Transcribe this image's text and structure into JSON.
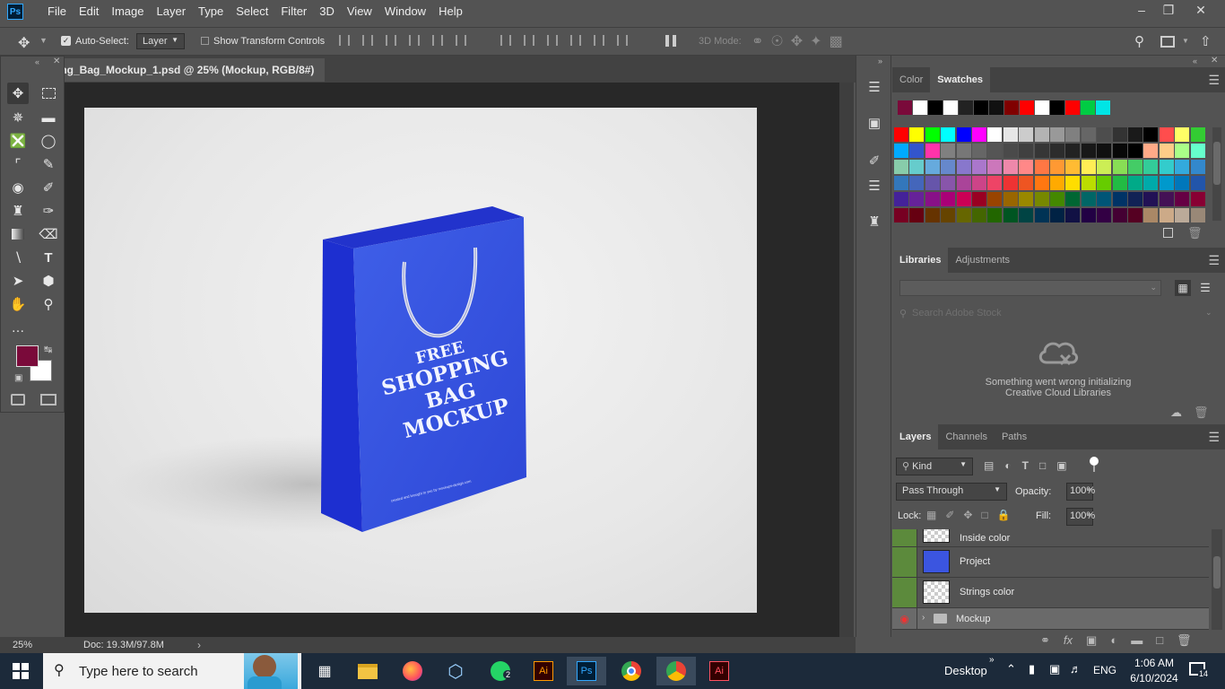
{
  "menu": [
    "File",
    "Edit",
    "Image",
    "Layer",
    "Type",
    "Select",
    "Filter",
    "3D",
    "View",
    "Window",
    "Help"
  ],
  "app_logo": "Ps",
  "options": {
    "auto_select_label": "Auto-Select:",
    "auto_select_value": "Layer",
    "show_transform_label": "Show Transform Controls",
    "mode_3d_label": "3D Mode:"
  },
  "document": {
    "tab_title": "ing_Bag_Mockup_1.psd @ 25% (Mockup, RGB/8#)",
    "close": "×",
    "zoom": "25%",
    "doc_info": "Doc: 19.3M/97.8M"
  },
  "mockup": {
    "line1": "FREE",
    "line2": "SHOPPING",
    "line3": "BAG MOCKUP",
    "footer": "created and brought to you by mockups-design.com"
  },
  "color_panel": {
    "tabs": [
      "Color",
      "Swatches"
    ],
    "active_tab": "Swatches",
    "recent_swatches": [
      "#7a0a3a",
      "#ffffff",
      "#000000",
      "#ffffff",
      "#222222",
      "#000000",
      "#111111",
      "#800000",
      "#ff0000",
      "#ffffff",
      "#000000",
      "#ff0000",
      "#00cc44",
      "#00e5e5"
    ],
    "swatch_rows": [
      [
        "#ff0000",
        "#ffff00",
        "#00ff00",
        "#00ffff",
        "#0000ff",
        "#ff00ff",
        "#ffffff",
        "#e6e6e6",
        "#cccccc",
        "#b3b3b3",
        "#999999",
        "#808080",
        "#666666",
        "#4d4d4d",
        "#333333",
        "#1a1a1a",
        "#000000",
        "#ff4d4d",
        "#ffff66",
        "#33cc33"
      ],
      [
        "#00aaff",
        "#3355cc",
        "#ff33aa",
        "#808080",
        "#777777",
        "#666666",
        "#555555",
        "#4a4a4a",
        "#404040",
        "#363636",
        "#2c2c2c",
        "#222222",
        "#181818",
        "#101010",
        "#080808",
        "#000000",
        "#ffaa88",
        "#ffcc88",
        "#aaff88",
        "#66ffcc"
      ],
      [
        "#88ccaa",
        "#66cccc",
        "#66aadd",
        "#6688cc",
        "#8877cc",
        "#aa77cc",
        "#cc77bb",
        "#ee88aa",
        "#ff8888",
        "#ff7744",
        "#ff9933",
        "#ffbb33",
        "#ffee55",
        "#ccee55",
        "#88dd55",
        "#44cc66",
        "#33cc99",
        "#33cccc",
        "#33aadd",
        "#3388cc"
      ],
      [
        "#3377bb",
        "#4466bb",
        "#6655aa",
        "#8855aa",
        "#aa4499",
        "#cc4488",
        "#ee4466",
        "#ee3333",
        "#ee5522",
        "#ff7711",
        "#ffaa00",
        "#ffdd00",
        "#bbdd00",
        "#66cc00",
        "#22bb44",
        "#00aa88",
        "#00aaaa",
        "#0099cc",
        "#0077bb",
        "#2255aa"
      ],
      [
        "#442299",
        "#662299",
        "#881188",
        "#aa0077",
        "#cc0055",
        "#990022",
        "#994400",
        "#996600",
        "#998800",
        "#778800",
        "#448800",
        "#006633",
        "#006666",
        "#005577",
        "#003366",
        "#112255",
        "#221155",
        "#441155",
        "#660044",
        "#880033"
      ],
      [
        "#770022",
        "#660011",
        "#663300",
        "#664400",
        "#666600",
        "#446600",
        "#226600",
        "#005522",
        "#004444",
        "#003355",
        "#002244",
        "#111144",
        "#220044",
        "#330044",
        "#440033",
        "#550022",
        "#aa8866",
        "#ccaa88",
        "#bbaa99",
        "#998877"
      ]
    ]
  },
  "libraries_panel": {
    "tabs": [
      "Libraries",
      "Adjustments"
    ],
    "active_tab": "Libraries",
    "search_placeholder": "Search Adobe Stock",
    "error_line1": "Something went wrong initializing",
    "error_line2": "Creative Cloud Libraries"
  },
  "layers_panel": {
    "tabs": [
      "Layers",
      "Channels",
      "Paths"
    ],
    "active_tab": "Layers",
    "kind_filter": "Kind",
    "blend_mode": "Pass Through",
    "opacity_label": "Opacity:",
    "opacity_value": "100%",
    "lock_label": "Lock:",
    "fill_label": "Fill:",
    "fill_value": "100%",
    "layers": [
      {
        "name": "Inside color"
      },
      {
        "name": "Project"
      },
      {
        "name": "Strings color"
      },
      {
        "name": "Mockup"
      }
    ]
  },
  "taskbar": {
    "search_placeholder": "Type here to search",
    "desktop_label": "Desktop",
    "language": "ENG",
    "time": "1:06 AM",
    "date": "6/10/2024",
    "notifications": "14",
    "whatsapp_badge": "2",
    "ai_label": "Ai"
  }
}
